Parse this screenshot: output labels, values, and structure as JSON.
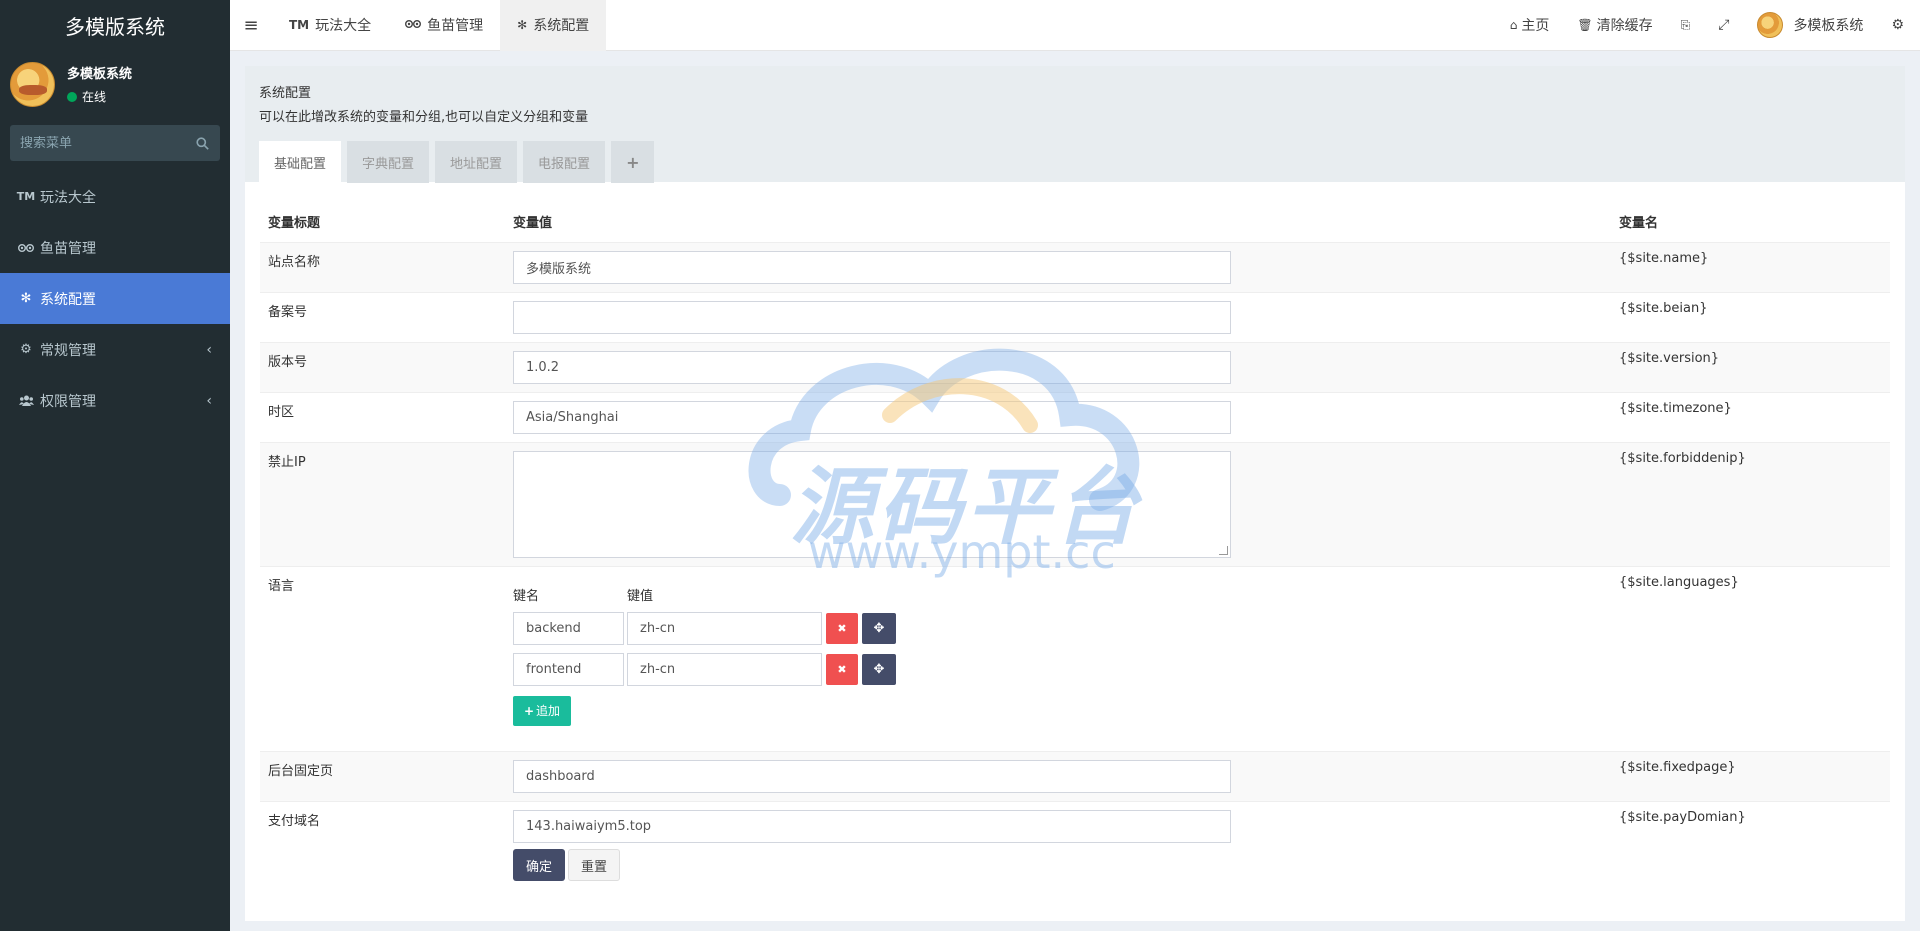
{
  "app": {
    "brand": "多模版系统"
  },
  "user": {
    "name": "多模板系统",
    "status": "在线"
  },
  "sidebar": {
    "search_placeholder": "搜索菜单",
    "items": [
      {
        "label": "玩法大全",
        "icon": "tm-icon"
      },
      {
        "label": "鱼苗管理",
        "icon": "tripadvisor-icon"
      },
      {
        "label": "系统配置",
        "icon": "gear-icon",
        "active": true
      },
      {
        "label": "常规管理",
        "icon": "cogs-icon"
      },
      {
        "label": "权限管理",
        "icon": "group-icon"
      }
    ]
  },
  "topbar": {
    "tabs": [
      {
        "label": "玩法大全",
        "icon": "tm-icon"
      },
      {
        "label": "鱼苗管理",
        "icon": "tripadvisor-icon"
      },
      {
        "label": "系统配置",
        "icon": "gear-icon",
        "active": true
      }
    ],
    "home": "主页",
    "clear_cache": "清除缓存",
    "user_name": "多模板系统"
  },
  "panel": {
    "title": "系统配置",
    "description": "可以在此增改系统的变量和分组,也可以自定义分组和变量",
    "tabs": [
      "基础配置",
      "字典配置",
      "地址配置",
      "电报配置"
    ]
  },
  "table": {
    "headers": [
      "变量标题",
      "变量值",
      "变量名"
    ],
    "rows": [
      {
        "title": "站点名称",
        "value": "多模版系统",
        "var": "{$site.name}"
      },
      {
        "title": "备案号",
        "value": "",
        "var": "{$site.beian}"
      },
      {
        "title": "版本号",
        "value": "1.0.2",
        "var": "{$site.version}"
      },
      {
        "title": "时区",
        "value": "Asia/Shanghai",
        "var": "{$site.timezone}"
      },
      {
        "title": "禁止IP",
        "value": "",
        "var": "{$site.forbiddenip}"
      },
      {
        "title": "语言",
        "var": "{$site.languages}"
      },
      {
        "title": "后台固定页",
        "value": "dashboard",
        "var": "{$site.fixedpage}"
      },
      {
        "title": "支付域名",
        "value": "143.haiwaiym5.top",
        "var": "{$site.payDomian}"
      }
    ],
    "languages": {
      "key_header": "键名",
      "value_header": "键值",
      "pairs": [
        {
          "key": "backend",
          "value": "zh-cn"
        },
        {
          "key": "frontend",
          "value": "zh-cn"
        }
      ],
      "add_label": "追加"
    }
  },
  "actions": {
    "confirm": "确定",
    "reset": "重置"
  },
  "watermark": {
    "text": "源码平台",
    "url": "www.ympt.cc"
  },
  "colors": {
    "sidebar_bg": "#222d32",
    "active_menu": "#4a7ad6",
    "danger": "#f05050",
    "dark_btn": "#444c69",
    "success": "#1abc9c"
  }
}
